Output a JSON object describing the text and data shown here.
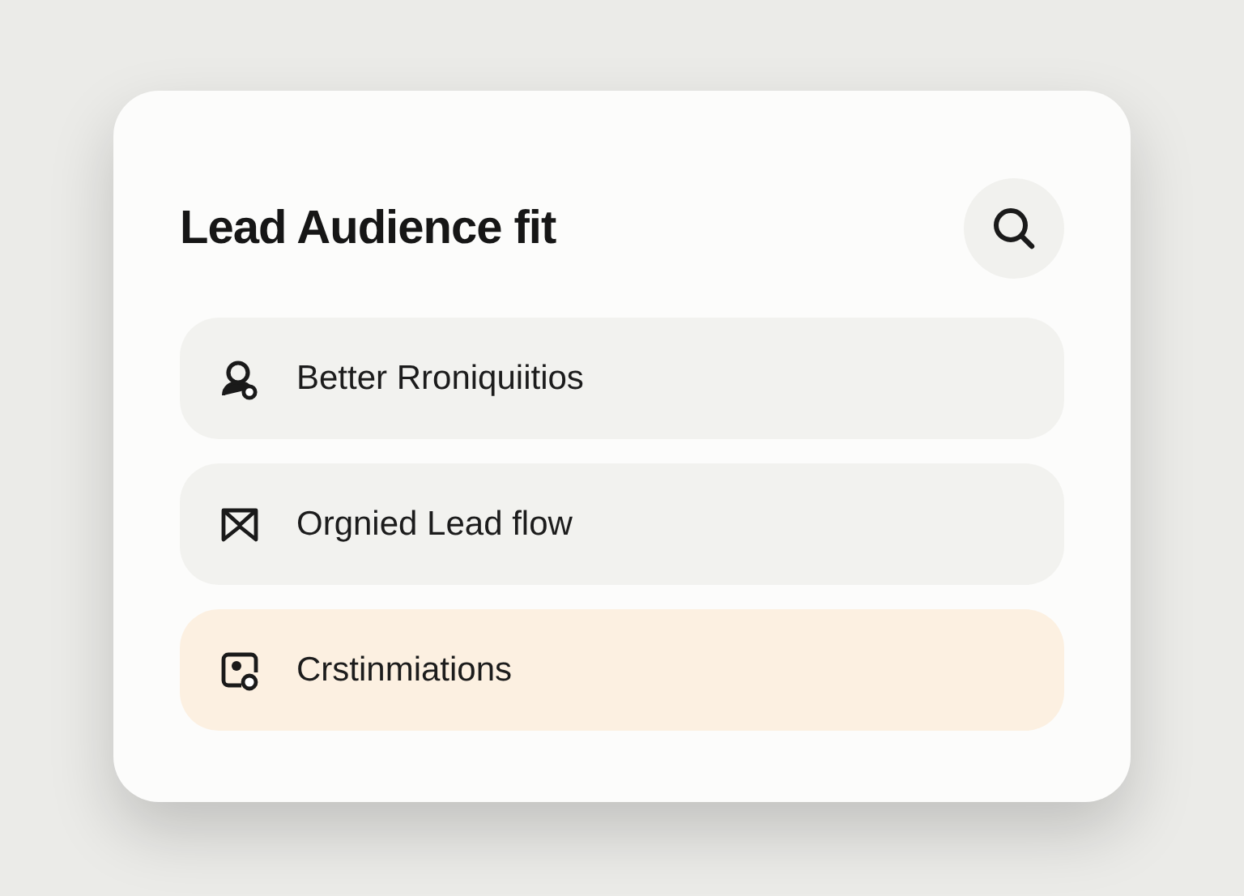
{
  "card": {
    "title": "Lead Audience fit"
  },
  "items": [
    {
      "label": "Better Rroniquiitios",
      "kind": "person",
      "selected": false
    },
    {
      "label": "Orgnied Lead flow",
      "kind": "envelope",
      "selected": false
    },
    {
      "label": "Crstinmiations",
      "kind": "photo",
      "selected": true
    }
  ]
}
